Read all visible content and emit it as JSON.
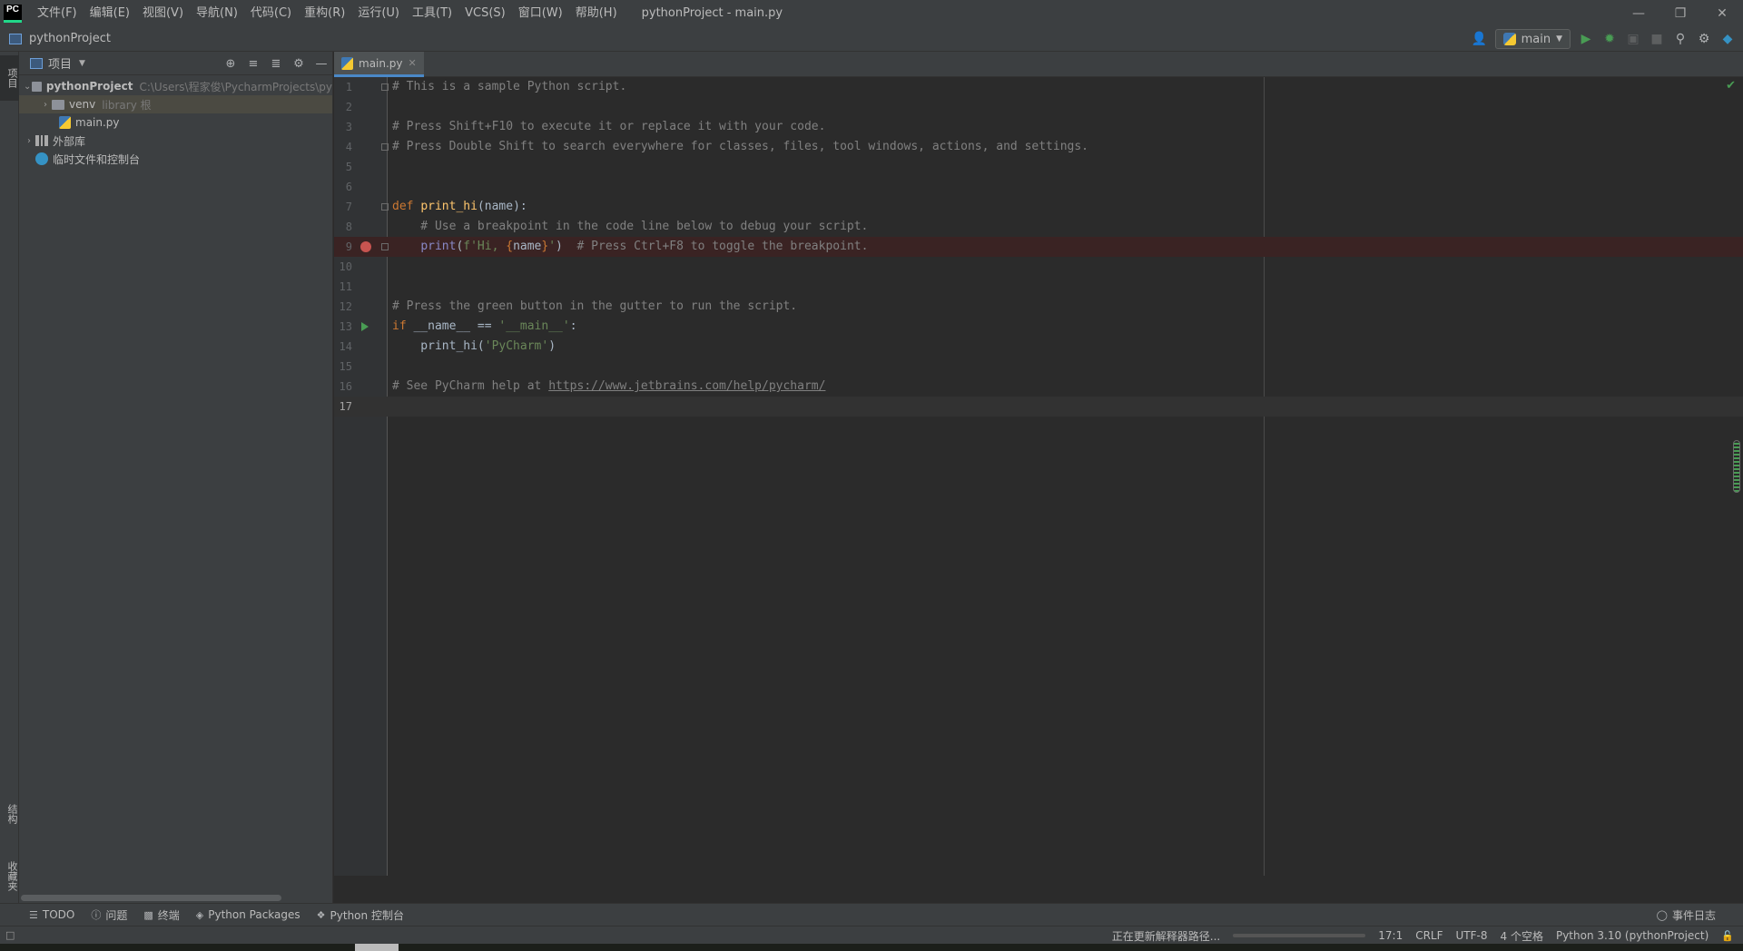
{
  "window": {
    "logo_text": "PC",
    "title": "pythonProject - main.py",
    "menu": [
      "文件(F)",
      "编辑(E)",
      "视图(V)",
      "导航(N)",
      "代码(C)",
      "重构(R)",
      "运行(U)",
      "工具(T)",
      "VCS(S)",
      "窗口(W)",
      "帮助(H)"
    ]
  },
  "navbar": {
    "project": "pythonProject",
    "run_config": "main"
  },
  "left_strip": {
    "project_tab": "项目",
    "structure_tab": "结构",
    "favorites_tab": "收藏夹"
  },
  "project_panel": {
    "title": "项目",
    "tree": {
      "root_name": "pythonProject",
      "root_path": "C:\\Users\\程家俊\\PycharmProjects\\py",
      "venv_name": "venv",
      "venv_hint": "library 根",
      "main_file": "main.py",
      "external_libs": "外部库",
      "scratches": "临时文件和控制台"
    }
  },
  "editor": {
    "tab_label": "main.py",
    "line_numbers": [
      "1",
      "2",
      "3",
      "4",
      "5",
      "6",
      "7",
      "8",
      "9",
      "10",
      "11",
      "12",
      "13",
      "14",
      "15",
      "16",
      "17"
    ],
    "code": {
      "l1": "# This is a sample Python script.",
      "l3": "# Press Shift+F10 to execute it or replace it with your code.",
      "l4": "# Press Double Shift to search everywhere for classes, files, tool windows, actions, and settings.",
      "l7_kw": "def ",
      "l7_fn": "print_hi",
      "l7_rest": "(name):",
      "l8": "    # Use a breakpoint in the code line below to debug your script.",
      "l9_indent": "    ",
      "l9_builtin": "print",
      "l9_open": "(",
      "l9_str1": "f'Hi, ",
      "l9_brace_open": "{",
      "l9_var": "name",
      "l9_brace_close": "}",
      "l9_str2": "'",
      "l9_close": ")",
      "l9_comment": "  # Press Ctrl+F8 to toggle the breakpoint.",
      "l12": "# Press the green button in the gutter to run the script.",
      "l13_kw": "if ",
      "l13_mid": "__name__ == ",
      "l13_str": "'__main__'",
      "l13_end": ":",
      "l14_pre": "    print_hi(",
      "l14_str": "'PyCharm'",
      "l14_end": ")",
      "l16_pre": "# See PyCharm help at ",
      "l16_link": "https://www.jetbrains.com/help/pycharm/"
    }
  },
  "bottom_tools": {
    "todo": "TODO",
    "problems": "问题",
    "terminal": "终端",
    "packages": "Python Packages",
    "console": "Python 控制台",
    "event_log": "事件日志"
  },
  "status": {
    "task": "正在更新解释器路径...",
    "position": "17:1",
    "line_sep": "CRLF",
    "encoding": "UTF-8",
    "indent": "4 个空格",
    "interpreter": "Python 3.10 (pythonProject)"
  },
  "colors": {
    "background": "#2b2b2b",
    "panel": "#3c3f41",
    "keyword": "#cc7832",
    "function": "#ffc66d",
    "string": "#6a8759",
    "comment": "#808080",
    "breakpoint": "#c75450",
    "run_green": "#499c54"
  }
}
